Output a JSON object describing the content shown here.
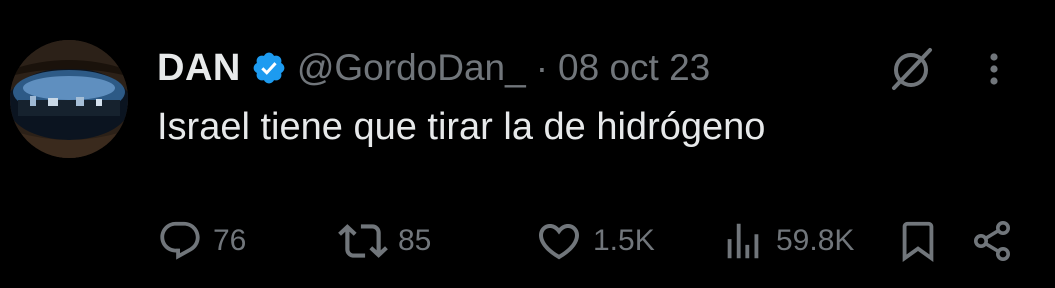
{
  "tweet": {
    "author": {
      "name": "DAN",
      "handle": "@GordoDan_",
      "separator": "·",
      "date": "08 oct 23",
      "verified_icon": "verified-badge-icon",
      "avatar": "sunglasses-reflection-avatar"
    },
    "text": "Israel tiene que tirar la de hidrógeno",
    "actions": {
      "replies": "76",
      "reposts": "85",
      "likes": "1.5K",
      "views": "59.8K"
    },
    "icons": {
      "reply": "reply-icon",
      "repost": "repost-icon",
      "like": "heart-icon",
      "views": "views-bar-chart-icon",
      "bookmark": "bookmark-icon",
      "share": "share-icon",
      "grok": "grok-icon",
      "more": "more-options-icon"
    },
    "colors": {
      "background": "#000000",
      "text_primary": "#e7e9ea",
      "text_secondary": "#71767b",
      "verified": "#1d9bf0"
    }
  }
}
